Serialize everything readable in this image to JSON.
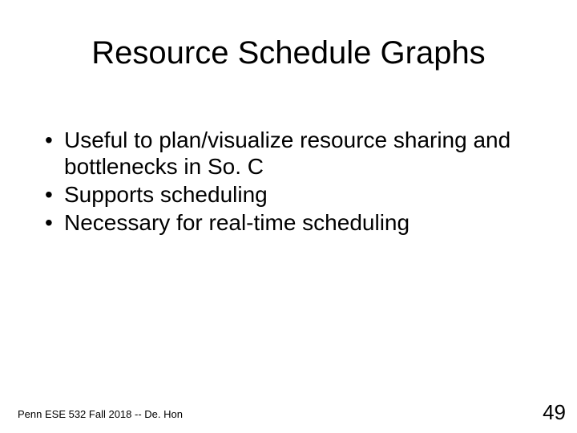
{
  "title": "Resource Schedule Graphs",
  "bullets": [
    "Useful to plan/visualize resource sharing and bottlenecks in So. C",
    "Supports scheduling",
    "Necessary for real-time scheduling"
  ],
  "footer": "Penn ESE 532 Fall 2018 -- De. Hon",
  "page_number": "49"
}
